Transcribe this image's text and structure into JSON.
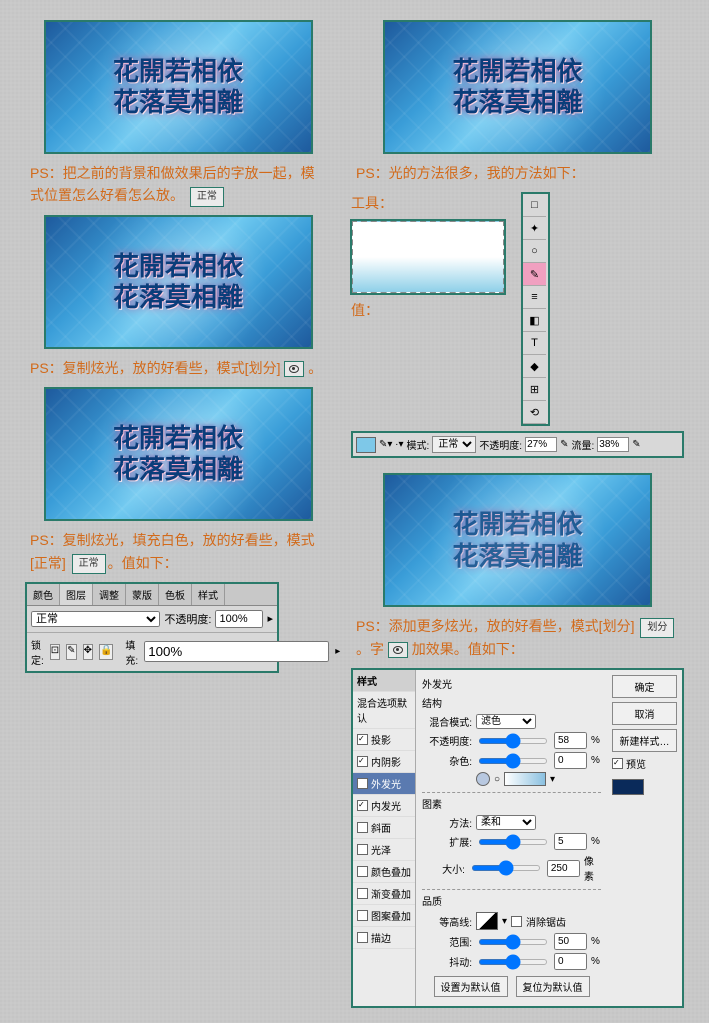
{
  "sample_line1": "花開若相依",
  "sample_line2": "花落莫相離",
  "left": {
    "note1": "PS：把之前的背景和做效果后的字放一起，模式位置怎么好看怎么放。",
    "note1_pill": "正常",
    "note2_a": "PS：复制炫光，放的好看些，模式[划分]",
    "note2_b": "。",
    "note3": "PS：复制炫光，填充白色，放的好看些，模式[正常]",
    "note3_pill": "正常",
    "note3_c": "。值如下：",
    "layers": {
      "tabs": [
        "颜色",
        "图层",
        "调整",
        "蒙版",
        "色板",
        "样式"
      ],
      "mode": "正常",
      "opacity_lbl": "不透明度:",
      "opacity": "100%",
      "lock_lbl": "锁定:",
      "fill_lbl": "填充:",
      "fill": "100%"
    }
  },
  "right": {
    "note1": "PS：光的方法很多，我的方法如下：",
    "tool_lbl": "工具：",
    "val_lbl": "值：",
    "toolbar": [
      "□",
      "✦",
      "○",
      "✎",
      "≡",
      "◧",
      "T",
      "◆",
      "⊞",
      "⟲"
    ],
    "opt": {
      "mode_lbl": "模式:",
      "mode": "正常",
      "op_lbl": "不透明度:",
      "op": "27%",
      "flow_lbl": "流量:",
      "flow": "38%"
    },
    "note2_a": "PS：添加更多炫光，放的好看些，模式[划分]",
    "note2_pill": "划分",
    "note2_b": "。字",
    "note2_c": "加效果。值如下：",
    "fx": {
      "title": "外发光",
      "list": [
        {
          "t": "样式",
          "hdr": true
        },
        {
          "t": "混合选项默认"
        },
        {
          "t": "投影",
          "ck": true
        },
        {
          "t": "内阴影",
          "ck": true
        },
        {
          "t": "外发光",
          "ck": true,
          "on": true
        },
        {
          "t": "内发光",
          "ck": true
        },
        {
          "t": "斜面",
          "ck": false
        },
        {
          "t": "光泽",
          "ck": false
        },
        {
          "t": "颜色叠加",
          "ck": false
        },
        {
          "t": "渐变叠加",
          "ck": false
        },
        {
          "t": "图案叠加",
          "ck": false
        },
        {
          "t": "描边",
          "ck": false
        }
      ],
      "struct": "结构",
      "blend_lbl": "混合模式:",
      "blend": "滤色",
      "op_lbl": "不透明度:",
      "op": "58",
      "noise_lbl": "杂色:",
      "noise": "0",
      "elem": "图素",
      "tech_lbl": "方法:",
      "tech": "柔和",
      "spread_lbl": "扩展:",
      "spread": "5",
      "size_lbl": "大小:",
      "size": "250",
      "qual": "品质",
      "contour_lbl": "等高线:",
      "anti": "消除锯齿",
      "range_lbl": "范围:",
      "range": "50",
      "jitter_lbl": "抖动:",
      "jitter": "0",
      "default_btn": "设置为默认值",
      "reset_btn": "复位为默认值",
      "ok": "确定",
      "cancel": "取消",
      "new": "新建样式…",
      "preview": "预览"
    }
  }
}
